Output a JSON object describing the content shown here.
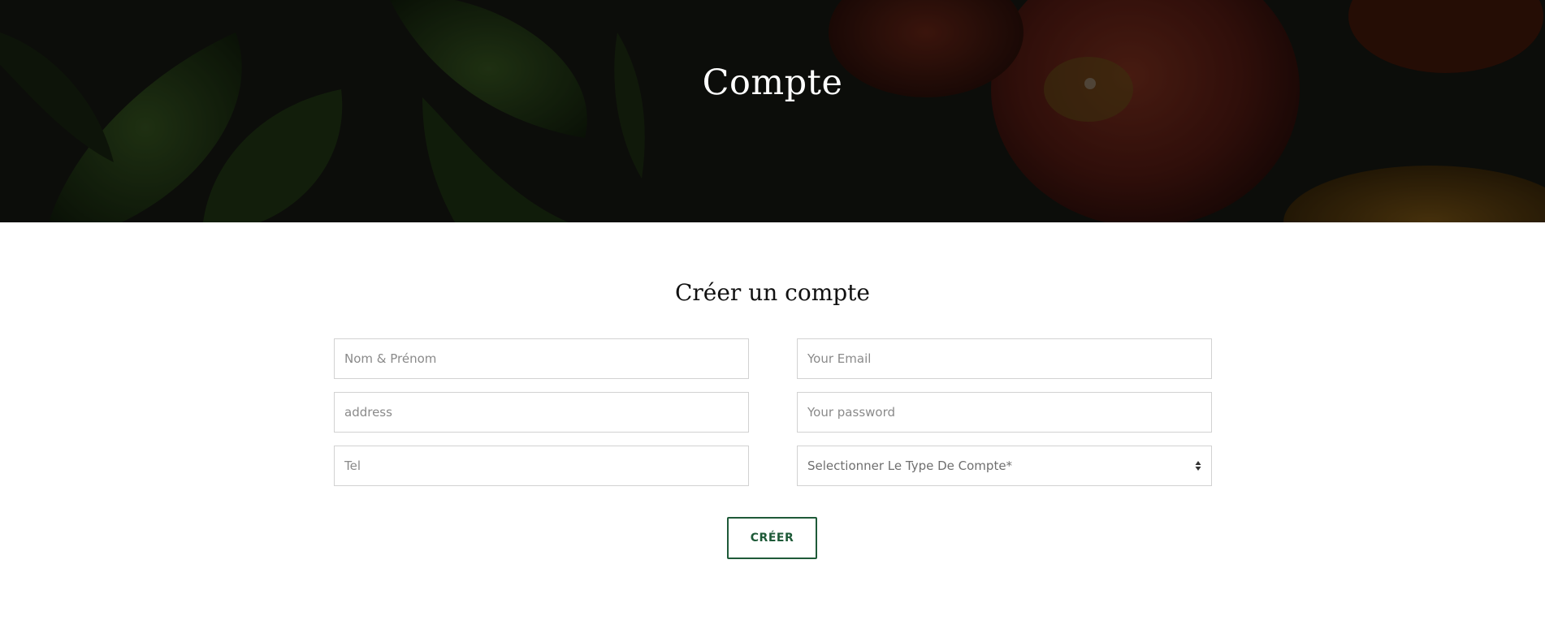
{
  "hero": {
    "title": "Compte"
  },
  "form": {
    "title": "Créer un compte",
    "fields": {
      "name_placeholder": "Nom & Prénom",
      "email_placeholder": "Your Email",
      "address_placeholder": "address",
      "password_placeholder": "Your password",
      "tel_placeholder": "Tel",
      "account_type_selected": "Selectionner Le Type De Compte*"
    },
    "submit_label": "CRÉER"
  },
  "colors": {
    "accent": "#1e5a38",
    "hero_overlay": "#0f100c",
    "border": "#d2d2d2"
  },
  "icons": {
    "select_caret": "up-down-caret-icon"
  }
}
